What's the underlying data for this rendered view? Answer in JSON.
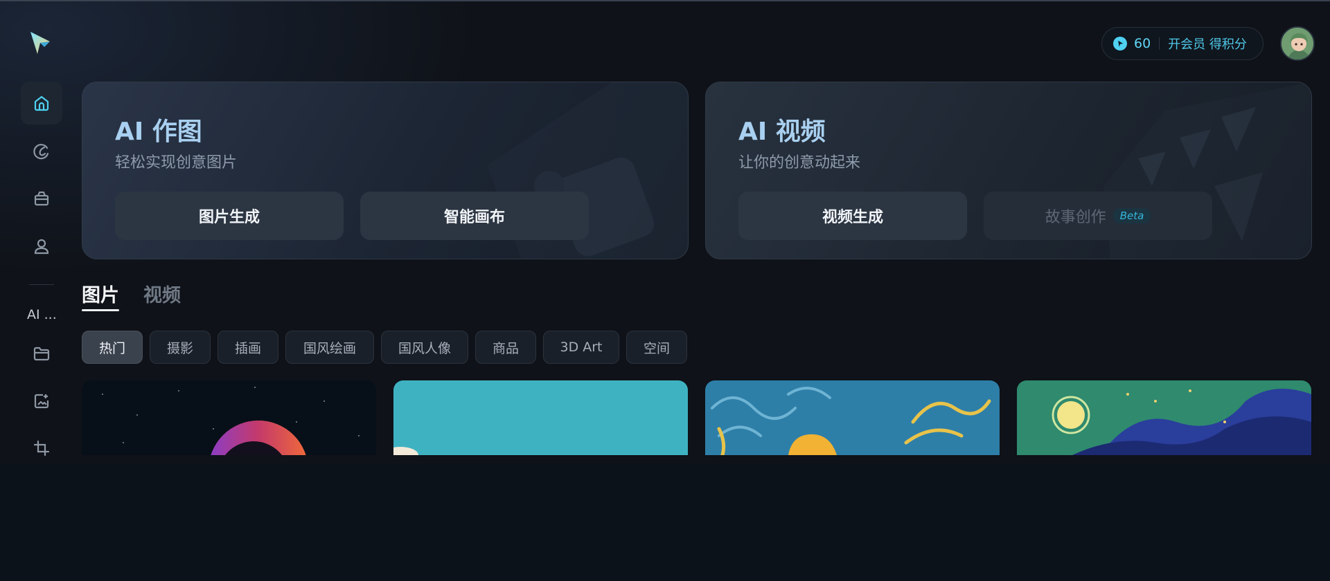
{
  "sidebar": {
    "items": [
      {
        "name": "home",
        "icon": "home-icon",
        "active": true
      },
      {
        "name": "swirl",
        "icon": "swirl-icon",
        "active": false
      },
      {
        "name": "box",
        "icon": "box-icon",
        "active": false
      },
      {
        "name": "user",
        "icon": "user-icon",
        "active": false
      }
    ],
    "section_label": "AI ...",
    "tools": [
      {
        "icon": "folder-icon"
      },
      {
        "icon": "image-edit-icon"
      },
      {
        "icon": "crop-icon"
      }
    ],
    "accent": "#4fd1f2"
  },
  "header": {
    "points": "60",
    "membership_link": "开会员 得积分"
  },
  "hero_cards": [
    {
      "title": "AI 作图",
      "subtitle": "轻松实现创意图片",
      "buttons": [
        {
          "label": "图片生成"
        },
        {
          "label": "智能画布"
        }
      ]
    },
    {
      "title": "AI 视频",
      "subtitle": "让你的创意动起来",
      "buttons": [
        {
          "label": "视频生成"
        },
        {
          "label": "故事创作",
          "badge": "Beta",
          "disabled": true
        }
      ]
    }
  ],
  "tabs": [
    {
      "label": "图片",
      "active": true
    },
    {
      "label": "视频",
      "active": false
    }
  ],
  "categories": [
    {
      "label": "热门",
      "active": true
    },
    {
      "label": "摄影"
    },
    {
      "label": "插画"
    },
    {
      "label": "国风绘画"
    },
    {
      "label": "国风人像"
    },
    {
      "label": "商品"
    },
    {
      "label": "3D Art"
    },
    {
      "label": "空间"
    }
  ],
  "gallery": [
    {
      "name": "astronaut-space"
    },
    {
      "name": "teal-sky"
    },
    {
      "name": "van-gogh-swirls"
    },
    {
      "name": "starry-night-waves"
    }
  ]
}
